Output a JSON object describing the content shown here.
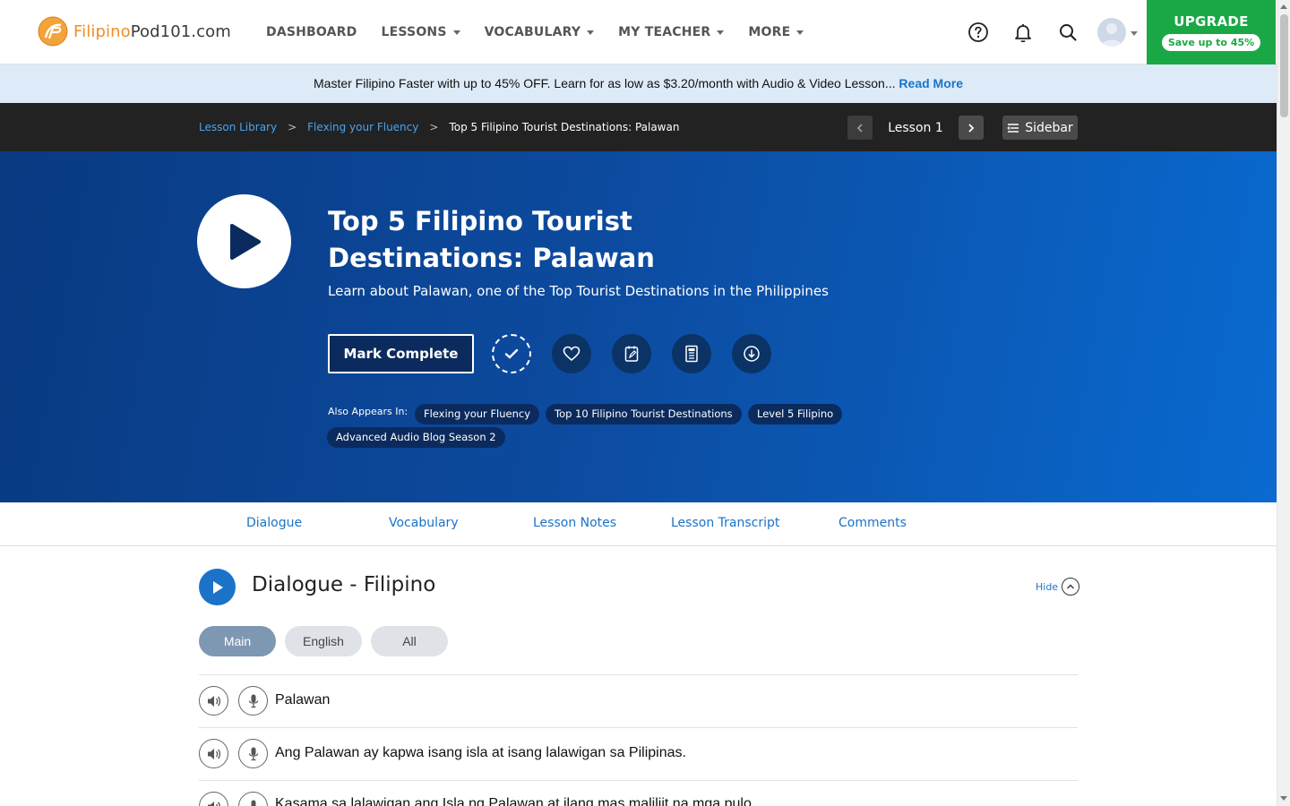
{
  "brand": {
    "part1": "Filipino",
    "part2": "Pod101.com"
  },
  "nav": {
    "items": [
      {
        "label": "DASHBOARD",
        "dropdown": false
      },
      {
        "label": "LESSONS",
        "dropdown": true
      },
      {
        "label": "VOCABULARY",
        "dropdown": true
      },
      {
        "label": "MY TEACHER",
        "dropdown": true
      },
      {
        "label": "MORE",
        "dropdown": true
      }
    ],
    "icons": [
      "help-icon",
      "bell-icon",
      "search-icon"
    ],
    "upgrade": {
      "title": "UPGRADE",
      "badge": "Save up to 45%"
    }
  },
  "promo": {
    "text": "Master Filipino Faster with up to 45% OFF. Learn for as low as $3.20/month with Audio & Video Lesson...",
    "link": "Read More"
  },
  "breadcrumb": {
    "items": [
      "Lesson Library",
      "Flexing your Fluency"
    ],
    "current": "Top 5 Filipino Tourist Destinations: Palawan",
    "lesson_label": "Lesson 1",
    "sidebar_label": "Sidebar"
  },
  "hero": {
    "title": "Top 5 Filipino Tourist Destinations: Palawan",
    "subtitle": "Learn about Palawan, one of the Top Tourist Destinations in the Philippines",
    "mark_complete": "Mark Complete",
    "appears_label": "Also Appears In:",
    "tags": [
      "Flexing your Fluency",
      "Top 10 Filipino Tourist Destinations",
      "Level 5 Filipino",
      "Advanced Audio Blog Season 2"
    ]
  },
  "tabs": [
    "Dialogue",
    "Vocabulary",
    "Lesson Notes",
    "Lesson Transcript",
    "Comments"
  ],
  "dialogue": {
    "title": "Dialogue - Filipino",
    "hide_label": "Hide",
    "filters": [
      "Main",
      "English",
      "All"
    ],
    "active_filter": "Main",
    "lines": [
      "Palawan",
      "Ang Palawan ay kapwa isang isla at isang lalawigan sa Pilipinas.",
      "Kasama sa lalawigan ang Isla ng Palawan at ilang mas maliliit na mga pulo."
    ]
  },
  "colors": {
    "accent": "#1a73c9",
    "upgrade": "#1aa846",
    "hero_dark": "#0a3a82",
    "hero_light": "#0a6ad0"
  }
}
